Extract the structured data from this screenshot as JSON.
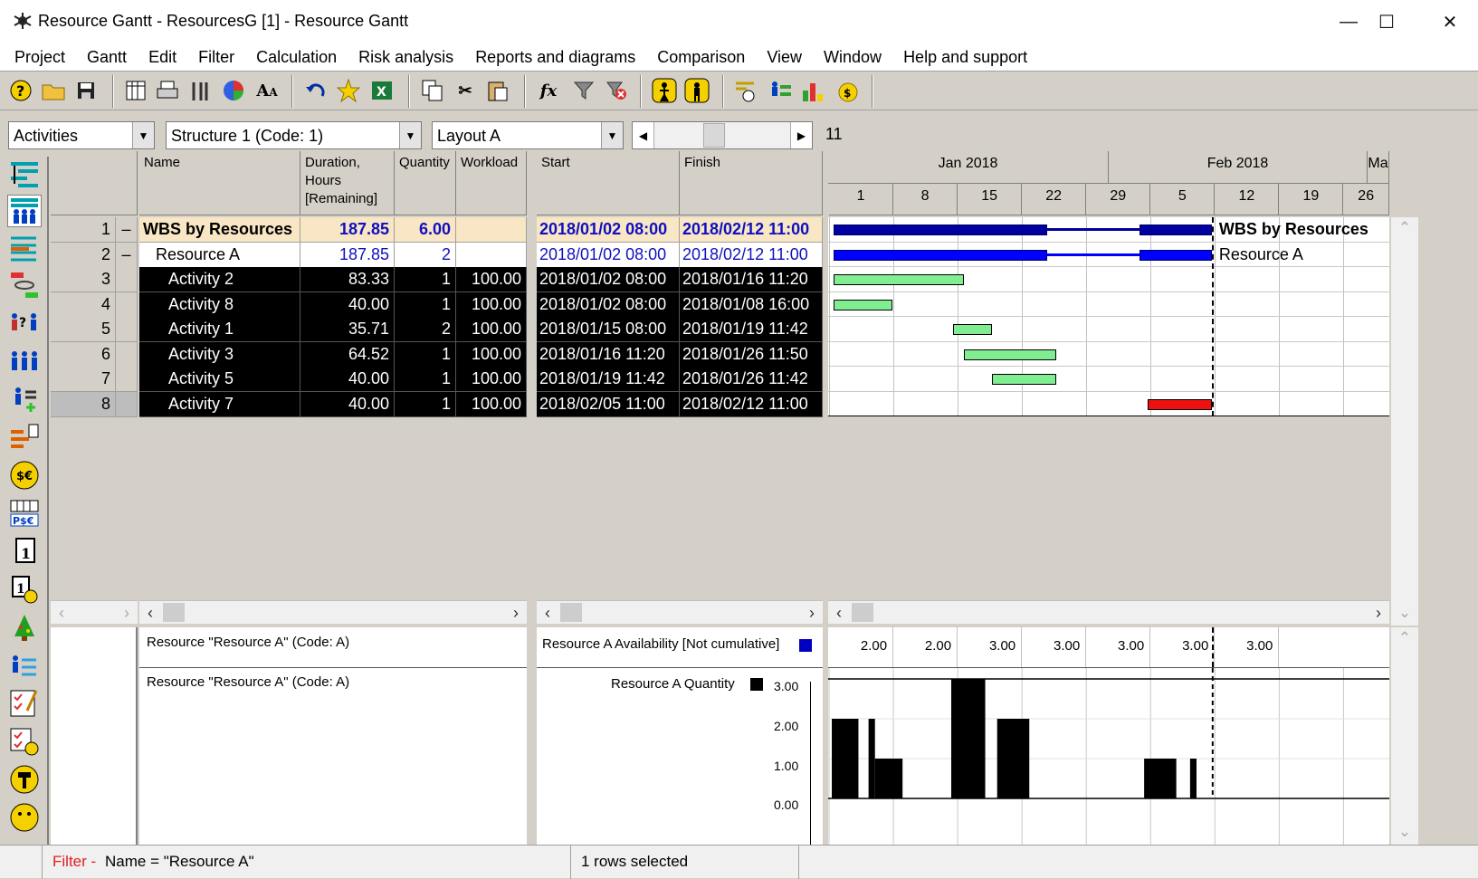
{
  "window": {
    "title": "Resource Gantt - ResourcesG [1] - Resource Gantt"
  },
  "menu": [
    "Project",
    "Gantt",
    "Edit",
    "Filter",
    "Calculation",
    "Risk analysis",
    "Reports and diagrams",
    "Comparison",
    "View",
    "Window",
    "Help and support"
  ],
  "combos": {
    "type": "Activities",
    "structure": "Structure 1 (Code: 1)",
    "layout": "Layout A",
    "count": "11"
  },
  "columns": {
    "name": "Name",
    "duration": "Duration,\nHours\n[Remaining]",
    "quantity": "Quantity",
    "workload": "Workload",
    "start": "Start",
    "finish": "Finish"
  },
  "timeline": {
    "months": [
      "Jan 2018",
      "Feb 2018",
      "Ma"
    ],
    "days": [
      "1",
      "8",
      "15",
      "22",
      "29",
      "5",
      "12",
      "19",
      "26"
    ]
  },
  "rows": [
    {
      "num": "1",
      "exp": "–",
      "name": "WBS by Resources",
      "duration": "187.85",
      "quantity": "6.00",
      "workload": "",
      "start": "2018/01/02  08:00",
      "finish": "2018/02/12  11:00",
      "label": "WBS by Resources"
    },
    {
      "num": "2",
      "exp": "–",
      "name": "Resource A",
      "duration": "187.85",
      "quantity": "2",
      "workload": "",
      "start": "2018/01/02  08:00",
      "finish": "2018/02/12  11:00",
      "label": "Resource A"
    },
    {
      "num": "3",
      "exp": "",
      "name": "Activity 2",
      "duration": "83.33",
      "quantity": "1",
      "workload": "100.00",
      "start": "2018/01/02  08:00",
      "finish": "2018/01/16  11:20",
      "label": ""
    },
    {
      "num": "4",
      "exp": "",
      "name": "Activity 8",
      "duration": "40.00",
      "quantity": "1",
      "workload": "100.00",
      "start": "2018/01/02  08:00",
      "finish": "2018/01/08  16:00",
      "label": ""
    },
    {
      "num": "5",
      "exp": "",
      "name": "Activity 1",
      "duration": "35.71",
      "quantity": "2",
      "workload": "100.00",
      "start": "2018/01/15  08:00",
      "finish": "2018/01/19  11:42",
      "label": ""
    },
    {
      "num": "6",
      "exp": "",
      "name": "Activity 3",
      "duration": "64.52",
      "quantity": "1",
      "workload": "100.00",
      "start": "2018/01/16  11:20",
      "finish": "2018/01/26  11:50",
      "label": ""
    },
    {
      "num": "7",
      "exp": "",
      "name": "Activity 5",
      "duration": "40.00",
      "quantity": "1",
      "workload": "100.00",
      "start": "2018/01/19  11:42",
      "finish": "2018/01/26  11:42",
      "label": ""
    },
    {
      "num": "8",
      "exp": "",
      "name": "Activity 7",
      "duration": "40.00",
      "quantity": "1",
      "workload": "100.00",
      "start": "2018/02/05  11:00",
      "finish": "2018/02/12  11:00",
      "label": ""
    }
  ],
  "gantt_bars": [
    {
      "row": 0,
      "type": "summary",
      "color": "#0000a0",
      "start_day": 1.33,
      "end_day": 42.46
    },
    {
      "row": 1,
      "type": "summary",
      "color": "#0000ff",
      "start_day": 1.33,
      "end_day": 42.46
    },
    {
      "row": 2,
      "type": "task",
      "color": "#80ee90",
      "start_day": 1.33,
      "end_day": 15.47
    },
    {
      "row": 3,
      "type": "task",
      "color": "#80ee90",
      "start_day": 1.33,
      "end_day": 7.67
    },
    {
      "row": 4,
      "type": "task",
      "color": "#80ee90",
      "start_day": 14.33,
      "end_day": 18.49
    },
    {
      "row": 5,
      "type": "task",
      "color": "#80ee90",
      "start_day": 15.47,
      "end_day": 25.49
    },
    {
      "row": 6,
      "type": "task",
      "color": "#80ee90",
      "start_day": 18.49,
      "end_day": 25.49
    },
    {
      "row": 7,
      "type": "task",
      "color": "#ee1111",
      "start_day": 35.46,
      "end_day": 42.46
    }
  ],
  "resource_panel": {
    "resource1": "Resource \"Resource A\" (Code: A)",
    "resource2": "Resource \"Resource A\" (Code: A)",
    "availability_label": "Resource A Availability [Not cumulative]",
    "quantity_label": "Resource A Quantity",
    "availability_values": [
      "2.00",
      "2.00",
      "3.00",
      "3.00",
      "3.00",
      "3.00",
      "3.00"
    ],
    "y_ticks": [
      "3.00",
      "2.00",
      "1.00",
      "0.00"
    ]
  },
  "chart_data": {
    "type": "bar",
    "title": "Resource A Quantity",
    "ylim": [
      0,
      3
    ],
    "segments": [
      {
        "start_day": 1.0,
        "end_day": 3.9,
        "value": 2
      },
      {
        "start_day": 5.0,
        "end_day": 5.7,
        "value": 2
      },
      {
        "start_day": 5.7,
        "end_day": 8.7,
        "value": 1
      },
      {
        "start_day": 14.0,
        "end_day": 17.7,
        "value": 3
      },
      {
        "start_day": 19.0,
        "end_day": 22.5,
        "value": 2
      },
      {
        "start_day": 35.0,
        "end_day": 38.5,
        "value": 1
      },
      {
        "start_day": 40.0,
        "end_day": 40.7,
        "value": 1
      }
    ]
  },
  "status": {
    "filter_label": "Filter -",
    "filter_text": "Name = \"Resource A\"",
    "selection": "1 rows selected"
  }
}
